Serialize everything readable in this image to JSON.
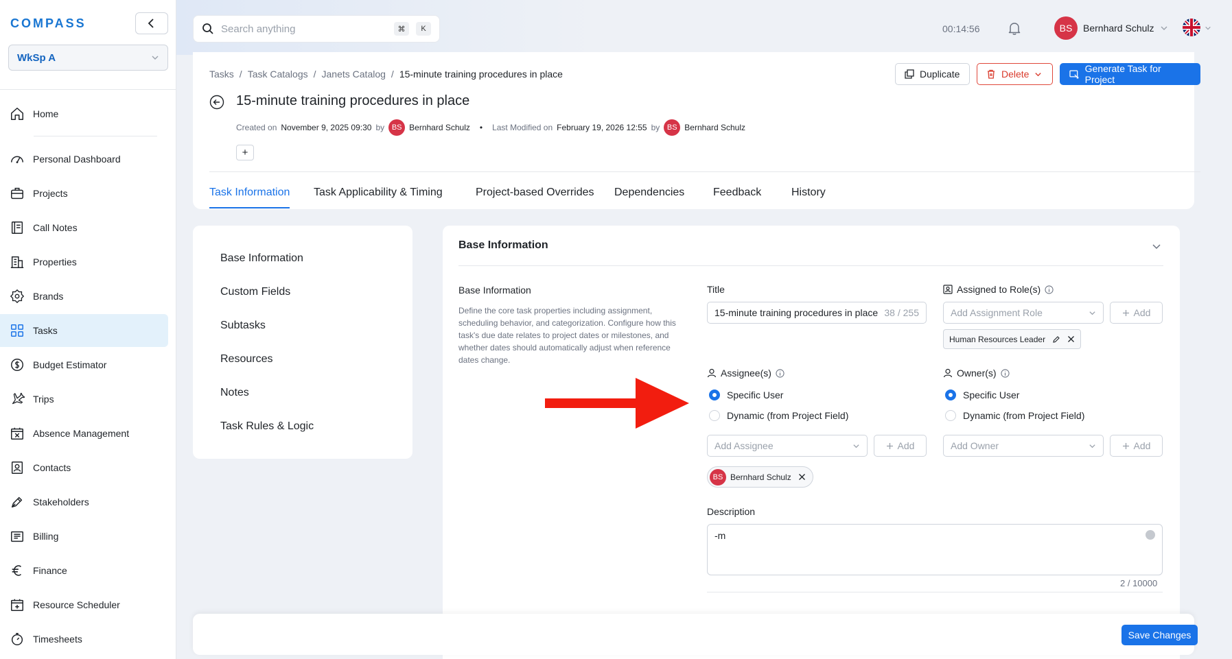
{
  "sidebar": {
    "logo": "COMPASS",
    "workspace": "WkSp A",
    "items": [
      {
        "label": "Home",
        "icon": "home-icon"
      },
      {
        "label": "Personal Dashboard",
        "icon": "gauge-icon"
      },
      {
        "label": "Projects",
        "icon": "briefcase-icon"
      },
      {
        "label": "Call Notes",
        "icon": "notebook-icon"
      },
      {
        "label": "Properties",
        "icon": "building-icon"
      },
      {
        "label": "Brands",
        "icon": "badge-icon"
      },
      {
        "label": "Tasks",
        "icon": "grid-icon",
        "active": true
      },
      {
        "label": "Budget Estimator",
        "icon": "dollar-icon"
      },
      {
        "label": "Trips",
        "icon": "plane-icon"
      },
      {
        "label": "Absence Management",
        "icon": "calendar-x-icon"
      },
      {
        "label": "Contacts",
        "icon": "contact-icon"
      },
      {
        "label": "Stakeholders",
        "icon": "pen-icon"
      },
      {
        "label": "Billing",
        "icon": "receipt-icon"
      },
      {
        "label": "Finance",
        "icon": "euro-icon"
      },
      {
        "label": "Resource Scheduler",
        "icon": "calendar-plus-icon"
      },
      {
        "label": "Timesheets",
        "icon": "stopwatch-icon"
      }
    ]
  },
  "topbar": {
    "search_placeholder": "Search anything",
    "kbd_cmd": "⌘",
    "kbd_k": "K",
    "timer": "00:14:56",
    "user_initials": "BS",
    "user_name": "Bernhard Schulz"
  },
  "header": {
    "breadcrumb": [
      "Tasks",
      "Task Catalogs",
      "Janets Catalog",
      "15-minute training procedures in place"
    ],
    "separator": "/",
    "title": "15-minute training procedures in place",
    "created_label": "Created on",
    "created_value": "November 9, 2025 09:30",
    "by": "by",
    "creator_initials": "BS",
    "creator_name": "Bernhard Schulz",
    "bullet": "•",
    "modified_label": "Last Modified on",
    "modified_value": "February 19, 2026 12:55",
    "modifier_initials": "BS",
    "modifier_name": "Bernhard Schulz",
    "plus": "+",
    "duplicate": "Duplicate",
    "delete": "Delete",
    "generate": "Generate Task for Project",
    "tabs": [
      "Task Information",
      "Task Applicability & Timing",
      "Project-based Overrides",
      "Dependencies",
      "Feedback",
      "History"
    ]
  },
  "sections": [
    "Base Information",
    "Custom Fields",
    "Subtasks",
    "Resources",
    "Notes",
    "Task Rules & Logic"
  ],
  "main": {
    "card_title": "Base Information",
    "section_label": "Base Information",
    "section_desc": "Define the core task properties including assignment, scheduling behavior, and categorization. Configure how this task's due date relates to project dates or milestones, and whether dates should automatically adjust when reference dates change.",
    "title_label": "Title",
    "title_value": "15-minute training procedures in place",
    "title_count": "38 / 255",
    "roles_label": "Assigned to Role(s)",
    "roles_placeholder": "Add Assignment Role",
    "add": "Add",
    "role_chip": "Human Resources Leader",
    "assignee_label": "Assignee(s)",
    "owner_label": "Owner(s)",
    "specific_user": "Specific User",
    "dynamic": "Dynamic (from Project Field)",
    "assignee_placeholder": "Add Assignee",
    "owner_placeholder": "Add Owner",
    "assignee_initials": "BS",
    "assignee_name": "Bernhard Schulz",
    "description_label": "Description",
    "description_value": "-m",
    "description_count": "2 / 10000"
  },
  "footer": {
    "save": "Save Changes"
  },
  "colors": {
    "accent": "#1a73e8",
    "danger": "#d93a2b",
    "avatar": "#d63447",
    "active_nav": "#e3f1fb",
    "annotation_arrow": "#f21d0f"
  }
}
